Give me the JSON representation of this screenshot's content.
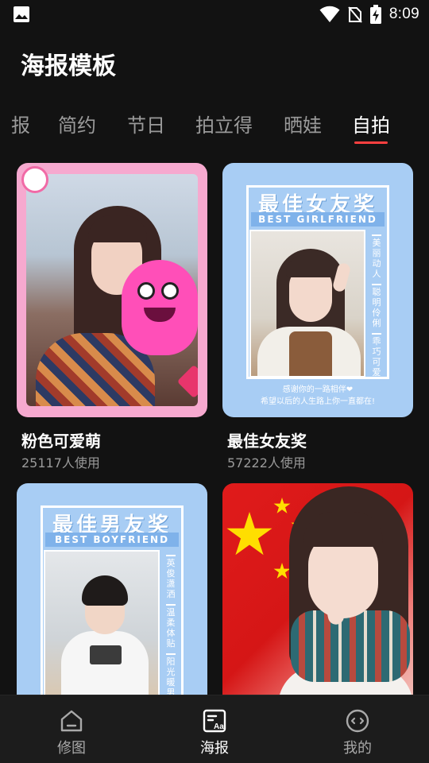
{
  "status_bar": {
    "time": "8:09",
    "icons": [
      "image-icon",
      "wifi-icon",
      "no-sim-icon",
      "battery-charging-icon"
    ]
  },
  "header": {
    "title": "海报模板"
  },
  "tabs": [
    {
      "label": "报"
    },
    {
      "label": "简约"
    },
    {
      "label": "节日"
    },
    {
      "label": "拍立得"
    },
    {
      "label": "晒娃"
    },
    {
      "label": "自拍",
      "active": true
    }
  ],
  "cards": [
    {
      "title": "粉色可爱萌",
      "usage": "25117人使用"
    },
    {
      "title": "最佳女友奖",
      "usage": "57222人使用",
      "poster": {
        "heading": "最佳女友奖",
        "subheading": "BEST GIRLFRIEND",
        "side": [
          "美丽动人",
          "聪明伶俐",
          "乖巧可爱"
        ],
        "caption1": "感谢你的一路相伴❤",
        "caption2": "希望以后的人生路上你一直都在!"
      }
    },
    {
      "title": "",
      "usage": "",
      "poster": {
        "heading": "最佳男友奖",
        "subheading": "BEST BOYFRIEND",
        "side": [
          "英俊潇洒",
          "温柔体贴",
          "阳光暖男"
        ]
      }
    },
    {
      "title": "",
      "usage": ""
    }
  ],
  "bottom_nav": [
    {
      "label": "修图",
      "icon": "home-icon"
    },
    {
      "label": "海报",
      "icon": "poster-icon",
      "active": true
    },
    {
      "label": "我的",
      "icon": "face-icon"
    }
  ],
  "colors": {
    "background": "#121212",
    "accent": "#ff4040",
    "nav_background": "#1c1c1c",
    "poster_blue": "#a8cdf4",
    "poster_pink": "#f6a9cf"
  }
}
